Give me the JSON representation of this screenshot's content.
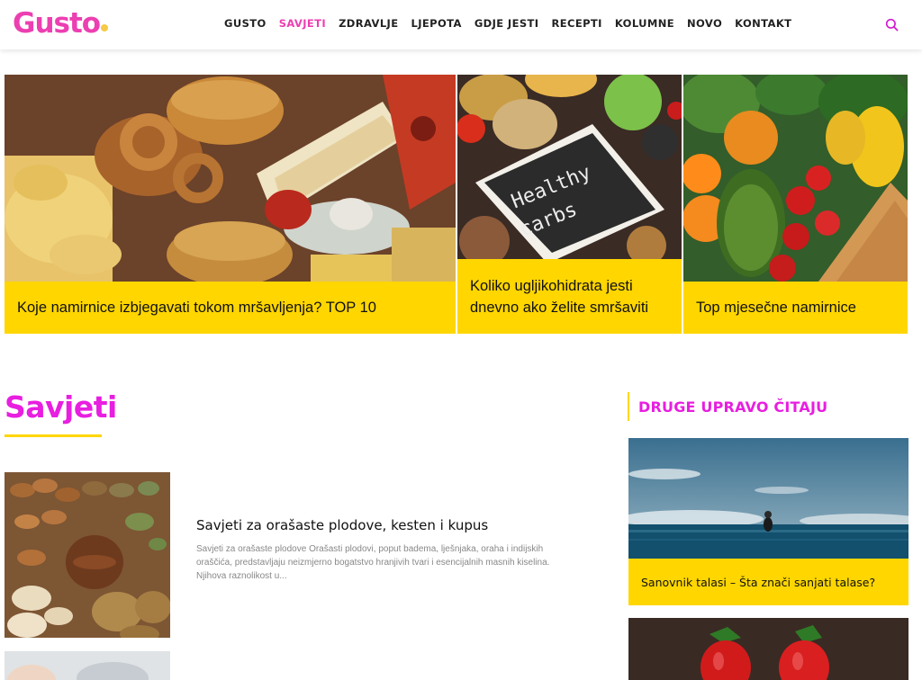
{
  "brand": {
    "logo": "Gusto"
  },
  "nav": {
    "items": [
      {
        "label": "GUSTO",
        "active": false
      },
      {
        "label": "SAVJETI",
        "active": true
      },
      {
        "label": "ZDRAVLJE",
        "active": false
      },
      {
        "label": "LJEPOTA",
        "active": false
      },
      {
        "label": "GDJE JESTI",
        "active": false
      },
      {
        "label": "RECEPTI",
        "active": false
      },
      {
        "label": "KOLUMNE",
        "active": false
      },
      {
        "label": "NOVO",
        "active": false
      },
      {
        "label": "KONTAKT",
        "active": false
      }
    ],
    "search_icon": "search-icon"
  },
  "colors": {
    "accent_pink": "#e81ee0",
    "accent_yellow": "#ffd600"
  },
  "features": [
    {
      "title": "Koje namirnice izbjegavati tokom mršavljenja? TOP 10",
      "image": "fast-food-photo"
    },
    {
      "title": "Koliko ugljikohidrata jesti dnevno ako želite smršaviti",
      "image": "healthy-carbs-photo"
    },
    {
      "title": "Top mjesečne namirnice",
      "image": "vegetables-photo"
    }
  ],
  "section": {
    "title": "Savjeti",
    "posts": [
      {
        "title": "Savjeti za orašaste plodove, kesten i kupus",
        "excerpt": "Savjeti za orašaste plodove Orašasti plodovi, poput badema, lješnjaka, oraha i indijskih oraščića, predstavljaju neizmjerno bogatstvo hranjivih tvari i esencijalnih masnih kiselina. Njihova raznolikost u...",
        "image": "nuts-photo"
      }
    ]
  },
  "sidebar": {
    "title": "DRUGE UPRAVO ČITAJU",
    "items": [
      {
        "title": "Sanovnik talasi – Šta znači sanjati talase?",
        "image": "sea-surfer-photo"
      },
      {
        "title": "",
        "image": "strawberries-photo"
      }
    ]
  }
}
